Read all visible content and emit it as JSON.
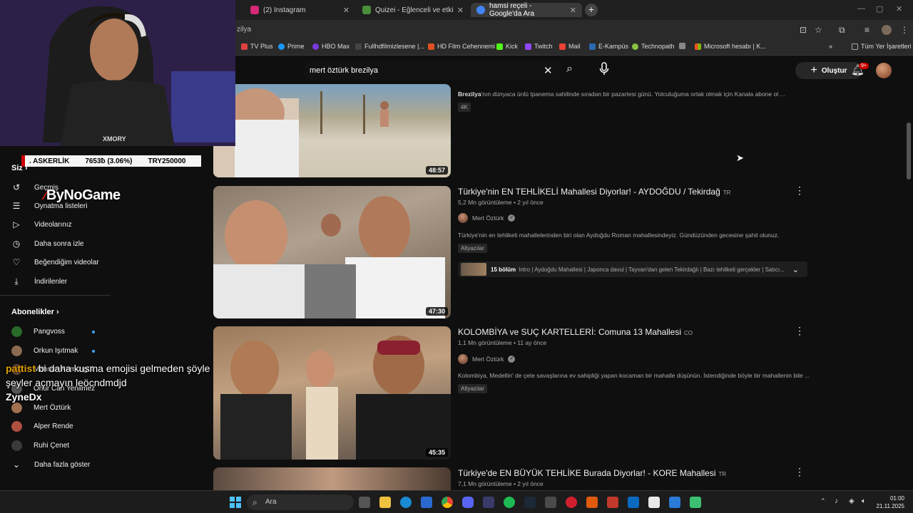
{
  "browser": {
    "tabs": [
      {
        "title": "(2) Instagram",
        "color": "#d62976"
      },
      {
        "title": "Quizei - Eğlenceli ve etkileşimli",
        "color": "#4a8f3a"
      },
      {
        "title": "hamsi reçeli - Google'da Ara",
        "color": "#4285f4",
        "active": true
      }
    ],
    "address": "zilya",
    "bookmarks": [
      {
        "label": "TV Plus",
        "color": "#e04040"
      },
      {
        "label": "Prime",
        "color": "#1a98ff"
      },
      {
        "label": "HBO Max",
        "color": "#7a3ae0"
      },
      {
        "label": "Fullhdfilmizlesene |...",
        "color": "#444"
      },
      {
        "label": "HD Film Cehennemi",
        "color": "#e05020"
      },
      {
        "label": "Kick",
        "color": "#53fc18"
      },
      {
        "label": "Twitch",
        "color": "#9146ff"
      },
      {
        "label": "Mail",
        "color": "#ea4335"
      },
      {
        "label": "E-Kampüs",
        "color": "#2a6ab0"
      },
      {
        "label": "Technopath",
        "color": "#8ac240"
      },
      {
        "label": "",
        "color": "#888"
      },
      {
        "label": "Microsoft hesabı | K...",
        "color": "#f25022"
      },
      {
        "label": "Tüm Yer İşaretleri",
        "color": "#aaa"
      }
    ]
  },
  "yt": {
    "search_query": "mert öztürk brezilya",
    "create_label": "Oluştur",
    "notif_count": "9+"
  },
  "overlay": {
    "ticker": {
      "name": ". ASKERLİK",
      "amount": "7653ƀ (3.06%)",
      "goal": "TRY250000"
    },
    "brand": "ByNoGame",
    "cam_text": "XMORY",
    "chat": [
      {
        "user": "pattist",
        "msg": " bi daha kusma emojisi gelmeden şöyle"
      },
      {
        "user": "",
        "msg": "şeyler açmayın leöcndmdjd"
      },
      {
        "user": "ZyneDx",
        "msg": ""
      }
    ]
  },
  "sidebar": {
    "you_label": "Siz",
    "items": [
      {
        "label": "Geçmiş",
        "icon": "history-icon",
        "glyph": "↺"
      },
      {
        "label": "Oynatma listeleri",
        "icon": "playlist-icon",
        "glyph": "☰"
      },
      {
        "label": "Videolarınız",
        "icon": "your-videos-icon",
        "glyph": "▷"
      },
      {
        "label": "Daha sonra izle",
        "icon": "watch-later-icon",
        "glyph": "◷"
      },
      {
        "label": "Beğendiğim videolar",
        "icon": "like-icon",
        "glyph": "👍"
      },
      {
        "label": "İndirilenler",
        "icon": "download-icon",
        "glyph": "⤓"
      }
    ],
    "subs_title": "Abonelikler",
    "subs": [
      {
        "label": "Pangvoss",
        "color": "#2a6a2a",
        "live": true
      },
      {
        "label": "Orkun Işıtmak",
        "color": "#8a6a50",
        "live": true
      },
      {
        "label": "Mahsun Kırmızıgül",
        "color": "#6a4a3a",
        "live": false
      },
      {
        "label": "Onur Can Yenilmez",
        "color": "#555",
        "live": false
      },
      {
        "label": "Mert Öztürk",
        "color": "#a07050",
        "live": false
      },
      {
        "label": "Alper Rende",
        "color": "#b05040",
        "live": false
      },
      {
        "label": "Ruhi Çenet",
        "color": "#3a3a3a",
        "live": false
      }
    ],
    "more_label": "Daha fazla göster"
  },
  "videos": [
    {
      "title": "",
      "desc_bold": "Brezilya",
      "desc": "'nın dünyaca ünlü Ipanema sahilinde sıradan bir pazartesi günü. Yolculuğuma ortak olmak için Kanala abone ol ...",
      "badge": "4K",
      "duration": "48:57"
    },
    {
      "title": "Türkiye'nin EN TEHLİKELİ Mahallesi Diyorlar! - AYDOĞDU / Tekirdağ",
      "lang": "TR",
      "meta": "5,2 Mn görüntüleme • 2 yıl önce",
      "channel": "Mert Öztürk",
      "desc": "Türkiye'nin en tehlikeli mahallelerinden biri olan Aydoğdu Roman mahallesindeyiz. Gündüzünden gecesine şahit olunuz.",
      "badge": "Altyazılar",
      "duration": "47:30",
      "chapters_count": "15 bölüm",
      "chapters_text": "Intro | Aydoğdu Mahallesi | Japonca davul | Tayvan'dan gelen Tekirdağlı | Bazı tehlikeli gerçekler | Satıcı..."
    },
    {
      "title": "KOLOMBİYA ve SUÇ KARTELLERİ: Comuna 13 Mahallesi",
      "lang": "CO",
      "meta": "1,1 Mn görüntüleme • 11 ay önce",
      "channel": "Mert Öztürk",
      "desc": "Kolombiya, Medellin' de çete savaşlarına ev sahipliği yapan kocaman bir mahalle düşünün. İstendiğinde böyle bir mahallenin bile ...",
      "badge": "Altyazılar",
      "duration": "45:35"
    },
    {
      "title": "Türkiye'de EN BÜYÜK TEHLİKE Burada Diyorlar! - KORE Mahallesi",
      "lang": "TR",
      "meta": "7,1 Mn görüntüleme • 2 yıl önce"
    }
  ],
  "taskbar": {
    "search_placeholder": "Ara",
    "time": "01:00",
    "date": "21.11.2025"
  }
}
